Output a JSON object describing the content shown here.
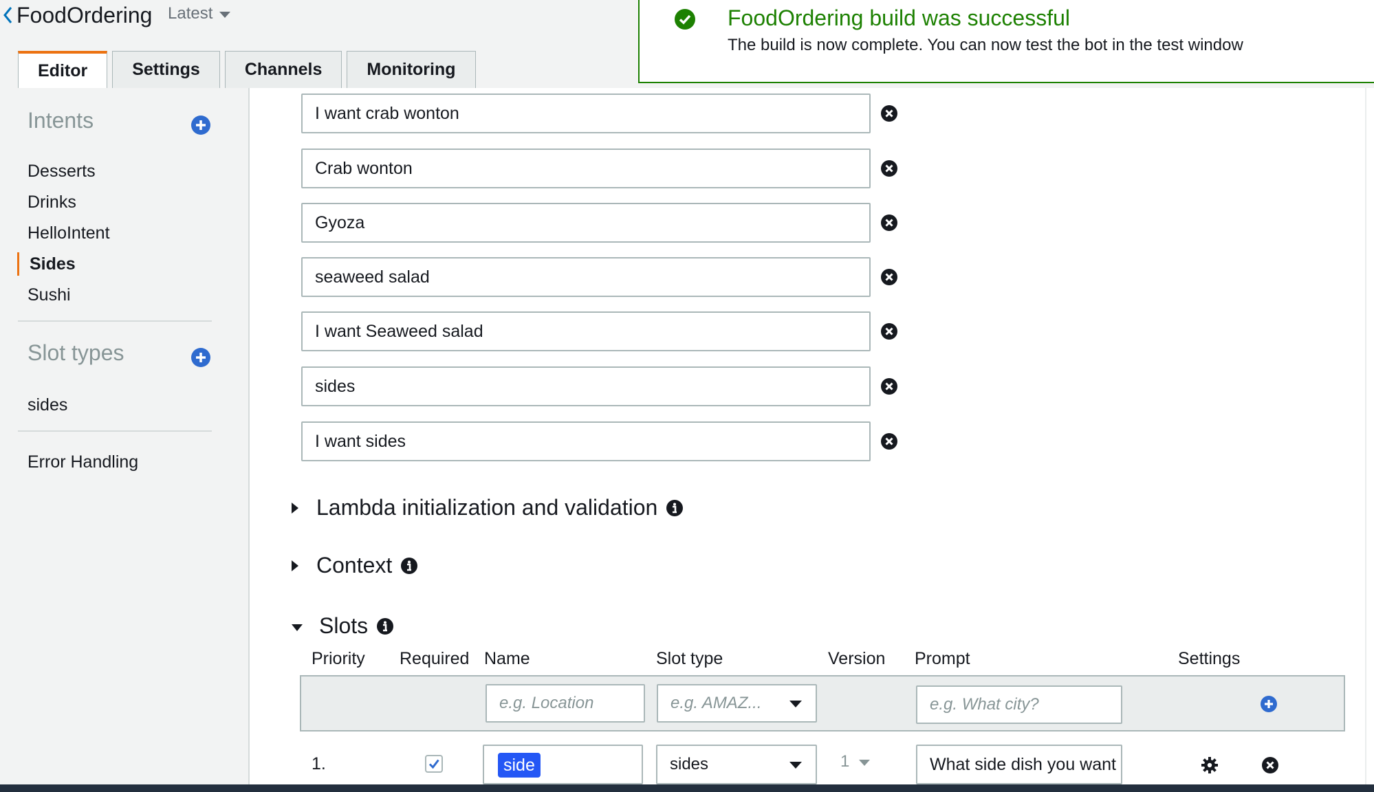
{
  "header": {
    "bot_name": "FoodOrdering",
    "version": "Latest",
    "tabs": [
      {
        "label": "Editor",
        "active": true
      },
      {
        "label": "Settings",
        "active": false
      },
      {
        "label": "Channels",
        "active": false
      },
      {
        "label": "Monitoring",
        "active": false
      }
    ]
  },
  "notification": {
    "title": "FoodOrdering build was successful",
    "message": "The build is now complete. You can now test the bot in the test window",
    "icon": "check-circle-icon",
    "color": "#1d8102"
  },
  "sidebar": {
    "intents_heading": "Intents",
    "intents": [
      "Desserts",
      "Drinks",
      "HelloIntent",
      "Sides",
      "Sushi"
    ],
    "active_intent": "Sides",
    "slot_types_heading": "Slot types",
    "slot_types": [
      "sides"
    ],
    "error_handling": "Error Handling"
  },
  "utterances": [
    "I want crab wonton",
    "Crab wonton",
    "Gyoza",
    "seaweed salad",
    "I want Seaweed salad",
    "sides",
    "I want sides"
  ],
  "sections": {
    "lambda": "Lambda initialization and validation",
    "context": "Context",
    "slots": "Slots"
  },
  "slots_table": {
    "headers": {
      "priority": "Priority",
      "required": "Required",
      "name": "Name",
      "slot_type": "Slot type",
      "version": "Version",
      "prompt": "Prompt",
      "settings": "Settings"
    },
    "new_row": {
      "name_placeholder": "e.g. Location",
      "slot_type_placeholder": "e.g. AMAZ...",
      "prompt_placeholder": "e.g. What city?"
    },
    "rows": [
      {
        "priority": "1.",
        "required": true,
        "name": "side",
        "slot_type": "sides",
        "version": "1",
        "prompt": "What side dish you want"
      }
    ]
  },
  "colors": {
    "accent_orange": "#ec7211",
    "add_blue": "#2f6bcf",
    "chip_blue": "#2457f5",
    "success_green": "#1d8102"
  }
}
